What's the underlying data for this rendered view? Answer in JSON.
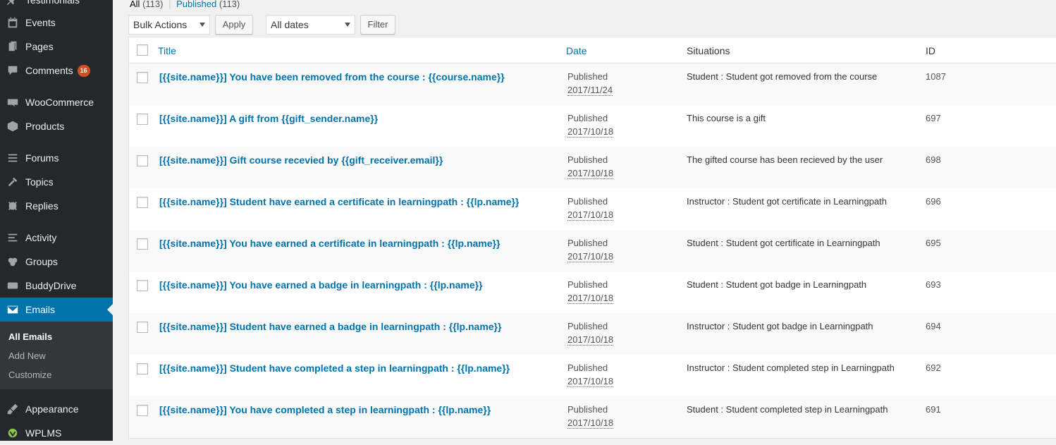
{
  "sidebar": {
    "items": [
      {
        "label": "Testimonials",
        "icon": "pin-icon"
      },
      {
        "label": "Events",
        "icon": "calendar-icon"
      },
      {
        "label": "Pages",
        "icon": "pages-icon"
      },
      {
        "label": "Comments",
        "icon": "comment-icon",
        "badge": "16"
      },
      {
        "label": "WooCommerce",
        "icon": "woo-icon"
      },
      {
        "label": "Products",
        "icon": "box-icon"
      },
      {
        "label": "Forums",
        "icon": "forums-icon"
      },
      {
        "label": "Topics",
        "icon": "tools-icon"
      },
      {
        "label": "Replies",
        "icon": "replies-icon"
      },
      {
        "label": "Activity",
        "icon": "activity-icon"
      },
      {
        "label": "Groups",
        "icon": "groups-icon"
      },
      {
        "label": "BuddyDrive",
        "icon": "drive-icon"
      },
      {
        "label": "Emails",
        "icon": "email-icon"
      },
      {
        "label": "Appearance",
        "icon": "brush-icon"
      },
      {
        "label": "WPLMS",
        "icon": "wplms-icon"
      }
    ],
    "submenu": [
      {
        "label": "All Emails"
      },
      {
        "label": "Add New"
      },
      {
        "label": "Customize"
      }
    ]
  },
  "filters": {
    "all_label": "All",
    "all_count": "(113)",
    "sep": "|",
    "published_label": "Published",
    "published_count": "(113)",
    "bulk_actions": "Bulk Actions",
    "apply": "Apply",
    "all_dates": "All dates",
    "filter": "Filter"
  },
  "table": {
    "headers": {
      "title": "Title",
      "date": "Date",
      "situations": "Situations",
      "id": "ID"
    },
    "rows": [
      {
        "title": "[{{site.name}}] You have been removed from the course : {{course.name}}",
        "status": "Published",
        "date": "2017/11/24",
        "situation": "Student : Student got removed from the course",
        "id": "1087"
      },
      {
        "title": "[{{site.name}}] A gift from {{gift_sender.name}}",
        "status": "Published",
        "date": "2017/10/18",
        "situation": "This course is a gift",
        "id": "697"
      },
      {
        "title": "[{{site.name}}] Gift course recevied by {{gift_receiver.email}}",
        "status": "Published",
        "date": "2017/10/18",
        "situation": "The gifted course has been recieved by the user",
        "id": "698"
      },
      {
        "title": "[{{site.name}}] Student have earned a certificate in learningpath : {{lp.name}}",
        "status": "Published",
        "date": "2017/10/18",
        "situation": "Instructor : Student got certificate in Learningpath",
        "id": "696"
      },
      {
        "title": "[{{site.name}}] You have earned a certificate in learningpath : {{lp.name}}",
        "status": "Published",
        "date": "2017/10/18",
        "situation": "Student : Student got certificate in Learningpath",
        "id": "695"
      },
      {
        "title": "[{{site.name}}] You have earned a badge in learningpath : {{lp.name}}",
        "status": "Published",
        "date": "2017/10/18",
        "situation": "Student : Student got badge in Learningpath",
        "id": "693"
      },
      {
        "title": "[{{site.name}}] Student have earned a badge in learningpath : {{lp.name}}",
        "status": "Published",
        "date": "2017/10/18",
        "situation": "Instructor : Student got badge in Learningpath",
        "id": "694"
      },
      {
        "title": "[{{site.name}}] Student have completed a step in learningpath : {{lp.name}}",
        "status": "Published",
        "date": "2017/10/18",
        "situation": "Instructor : Student completed step in Learningpath",
        "id": "692"
      },
      {
        "title": "[{{site.name}}] You have completed a step in learningpath : {{lp.name}}",
        "status": "Published",
        "date": "2017/10/18",
        "situation": "Student : Student completed step in Learningpath",
        "id": "691"
      }
    ]
  },
  "colors": {
    "link": "#0073aa",
    "sidebar": "#23282d",
    "current": "#0073aa",
    "badge": "#d54e21"
  }
}
